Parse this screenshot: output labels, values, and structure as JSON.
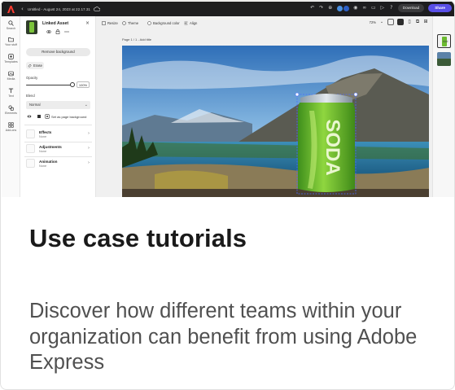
{
  "app": {
    "document_title": "Untitled - August 24, 2023 at 22.17.31",
    "back_glyph": "‹",
    "download_label": "Download",
    "share_label": "Share",
    "zoom": "72%"
  },
  "rail": {
    "items": [
      {
        "label": "Search",
        "icon": "search-icon"
      },
      {
        "label": "Your stuff",
        "icon": "folder-icon"
      },
      {
        "label": "Templates",
        "icon": "templates-icon"
      },
      {
        "label": "Media",
        "icon": "media-icon"
      },
      {
        "label": "Text",
        "icon": "text-icon"
      },
      {
        "label": "Elements",
        "icon": "elements-icon"
      },
      {
        "label": "Add-ons",
        "icon": "addons-icon"
      }
    ]
  },
  "panel": {
    "title": "Linked Asset",
    "remove_bg_label": "Remove background",
    "erase_label": "Erase",
    "opacity_label": "Opacity",
    "opacity_value": "100%",
    "opacity_level": 1.0,
    "blend_label": "Blend",
    "blend_value": "Normal",
    "set_page_bg_label": "Set as page background",
    "sections": [
      {
        "title": "Effects",
        "sub": "None"
      },
      {
        "title": "Adjustments",
        "sub": "None"
      },
      {
        "title": "Animation",
        "sub": "None"
      }
    ]
  },
  "canvas": {
    "toolbar": [
      "Resize",
      "Theme",
      "Background color",
      "Align"
    ],
    "page_label": "Page 1 / 1 - Add title",
    "product_text": "SODA",
    "add_label": "Add"
  },
  "card": {
    "heading": "Use case tutorials",
    "description": "Discover how different teams within your organization can benefit from using Adobe Express"
  },
  "colors": {
    "topbar": "#1d1d1f",
    "share": "#5a50e8",
    "can_green": "#7bc43a"
  }
}
